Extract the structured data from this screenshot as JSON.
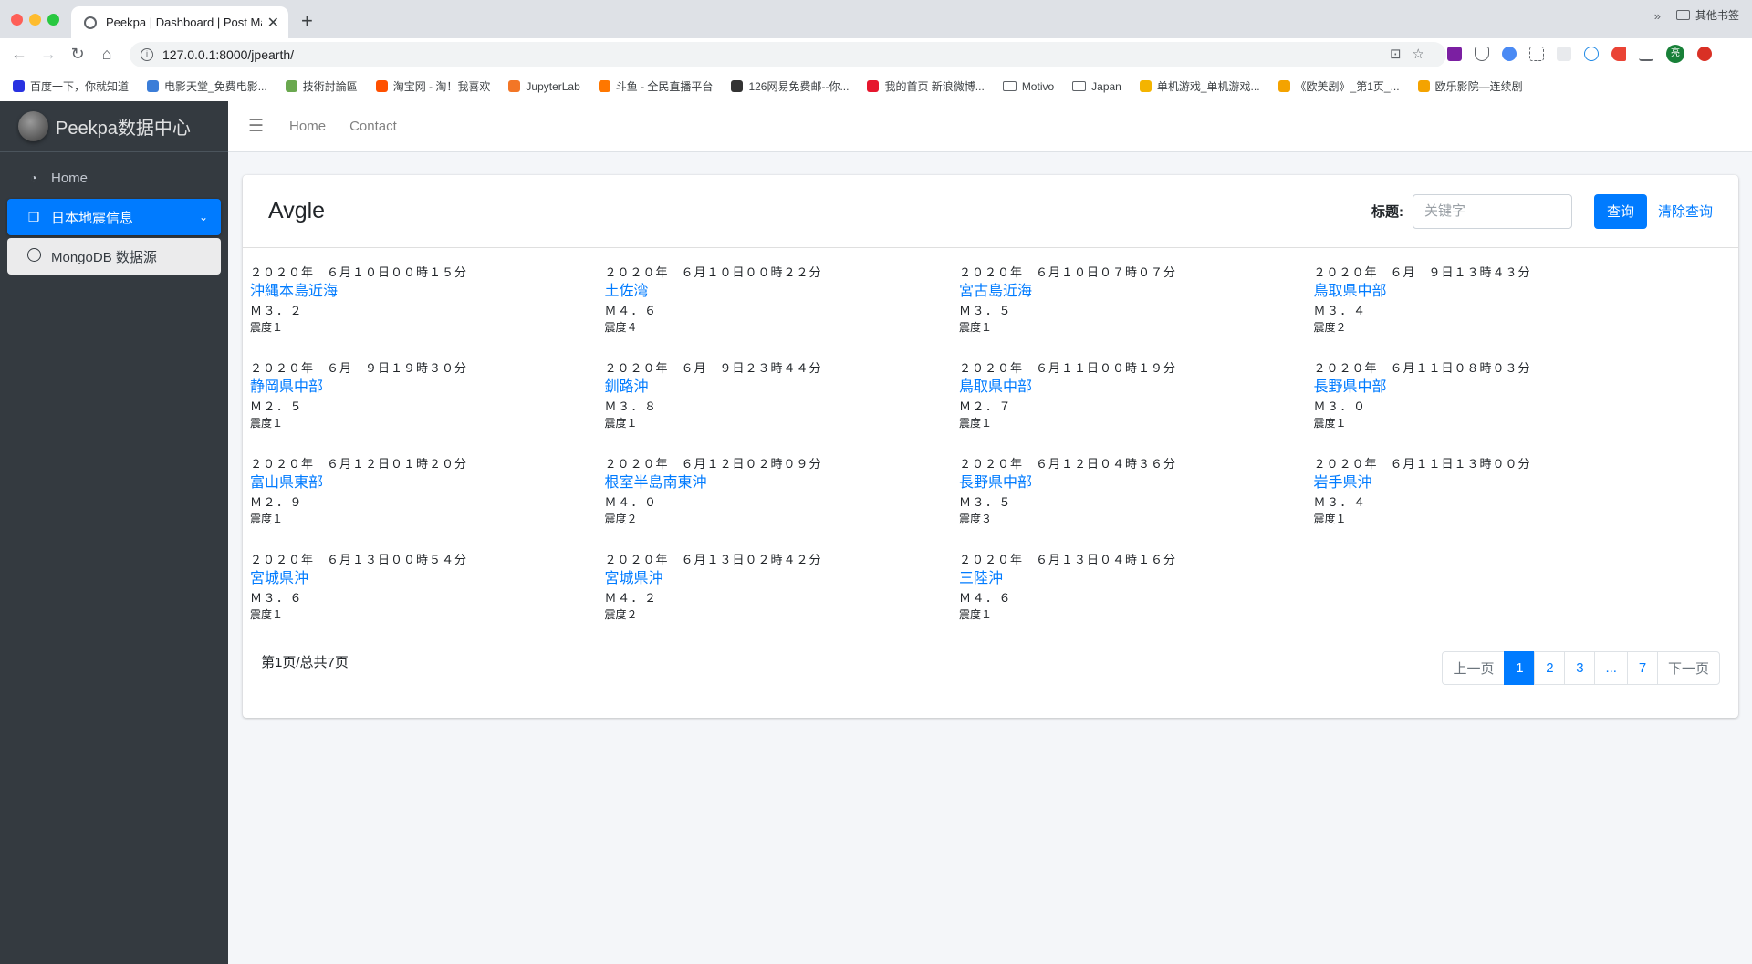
{
  "browser": {
    "tab_title": "Peekpa | Dashboard | Post Ma",
    "url": "127.0.0.1:8000/jpearth/",
    "profile_initial": "亮",
    "bookmarks": [
      {
        "label": "百度一下，你就知道",
        "color": "#2932e1"
      },
      {
        "label": "电影天堂_免费电影...",
        "color": "#3b7dd8"
      },
      {
        "label": "技術討論區",
        "color": "#6aa84f"
      },
      {
        "label": "淘宝网 - 淘！我喜欢",
        "color": "#ff5000"
      },
      {
        "label": "JupyterLab",
        "color": "#f37626"
      },
      {
        "label": "斗鱼 - 全民直播平台",
        "color": "#ff7700"
      },
      {
        "label": "126网易免费邮--你...",
        "color": "#333333"
      },
      {
        "label": "我的首页 新浪微博...",
        "color": "#e6162d"
      },
      {
        "label": "Motivo",
        "color": "folder"
      },
      {
        "label": "Japan",
        "color": "folder"
      },
      {
        "label": "单机游戏_单机游戏...",
        "color": "#f4b400"
      },
      {
        "label": "《欧美剧》_第1页_...",
        "color": "#f4a300"
      },
      {
        "label": "欧乐影院—连续剧",
        "color": "#f4a300"
      }
    ],
    "other_bookmarks": "其他书签"
  },
  "sidebar": {
    "brand": "Peekpa数据中心",
    "items": [
      {
        "label": "Home"
      },
      {
        "label": "日本地震信息"
      },
      {
        "label": "MongoDB 数据源"
      }
    ]
  },
  "topnav": {
    "links": [
      "Home",
      "Contact"
    ]
  },
  "card": {
    "title": "Avgle",
    "search_label": "标题:",
    "search_placeholder": "关键字",
    "query_button": "查询",
    "clear_button": "清除查询"
  },
  "quakes": [
    {
      "time": "２０２０年　６月１０日００時１５分",
      "place": "沖縄本島近海",
      "mag": "Ｍ３．２",
      "intensity": "震度１"
    },
    {
      "time": "２０２０年　６月１０日００時２２分",
      "place": "土佐湾",
      "mag": "Ｍ４．６",
      "intensity": "震度４"
    },
    {
      "time": "２０２０年　６月１０日０７時０７分",
      "place": "宮古島近海",
      "mag": "Ｍ３．５",
      "intensity": "震度１"
    },
    {
      "time": "２０２０年　６月　９日１３時４３分",
      "place": "鳥取県中部",
      "mag": "Ｍ３．４",
      "intensity": "震度２"
    },
    {
      "time": "２０２０年　６月　９日１９時３０分",
      "place": "静岡県中部",
      "mag": "Ｍ２．５",
      "intensity": "震度１"
    },
    {
      "time": "２０２０年　６月　９日２３時４４分",
      "place": "釧路沖",
      "mag": "Ｍ３．８",
      "intensity": "震度１"
    },
    {
      "time": "２０２０年　６月１１日００時１９分",
      "place": "鳥取県中部",
      "mag": "Ｍ２．７",
      "intensity": "震度１"
    },
    {
      "time": "２０２０年　６月１１日０８時０３分",
      "place": "長野県中部",
      "mag": "Ｍ３．０",
      "intensity": "震度１"
    },
    {
      "time": "２０２０年　６月１２日０１時２０分",
      "place": "富山県東部",
      "mag": "Ｍ２．９",
      "intensity": "震度１"
    },
    {
      "time": "２０２０年　６月１２日０２時０９分",
      "place": "根室半島南東沖",
      "mag": "Ｍ４．０",
      "intensity": "震度２"
    },
    {
      "time": "２０２０年　６月１２日０４時３６分",
      "place": "長野県中部",
      "mag": "Ｍ３．５",
      "intensity": "震度３"
    },
    {
      "time": "２０２０年　６月１１日１３時００分",
      "place": "岩手県沖",
      "mag": "Ｍ３．４",
      "intensity": "震度１"
    },
    {
      "time": "２０２０年　６月１３日００時５４分",
      "place": "宮城県沖",
      "mag": "Ｍ３．６",
      "intensity": "震度１"
    },
    {
      "time": "２０２０年　６月１３日０２時４２分",
      "place": "宮城県沖",
      "mag": "Ｍ４．２",
      "intensity": "震度２"
    },
    {
      "time": "２０２０年　６月１３日０４時１６分",
      "place": "三陸沖",
      "mag": "Ｍ４．６",
      "intensity": "震度１"
    }
  ],
  "pagination": {
    "info": "第1页/总共7页",
    "prev": "上一页",
    "pages": [
      "1",
      "2",
      "3",
      "...",
      "7"
    ],
    "next": "下一页"
  },
  "colors": {
    "primary": "#007bff",
    "sidebar_bg": "#343a40",
    "content_bg": "#f4f6f9"
  }
}
